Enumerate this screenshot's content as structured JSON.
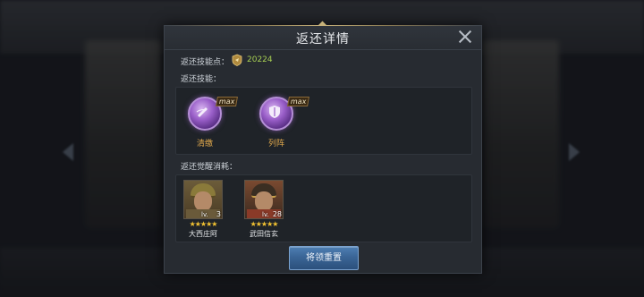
{
  "dialog": {
    "title": "返还详情",
    "points_label": "返还技能点：",
    "points_value": "20224",
    "skills_label": "返还技能：",
    "awaken_label": "返还觉醒消耗：",
    "reset_button": "将领重置"
  },
  "skills": [
    {
      "name": "清缴",
      "badge": "max",
      "icon": "sword-slash-icon"
    },
    {
      "name": "列阵",
      "badge": "max",
      "icon": "shield-icon"
    }
  ],
  "heroes": [
    {
      "name": "大西庄阿",
      "level_prefix": "lv.",
      "level": "3",
      "stars": "★★★★★"
    },
    {
      "name": "武田信玄",
      "level_prefix": "lv.",
      "level": "28",
      "stars": "★★★★★"
    }
  ],
  "colors": {
    "accent_green": "#a7cf52",
    "skill_name": "#e0a84c",
    "button_blue": "#3a6596",
    "star": "#f2c232"
  }
}
